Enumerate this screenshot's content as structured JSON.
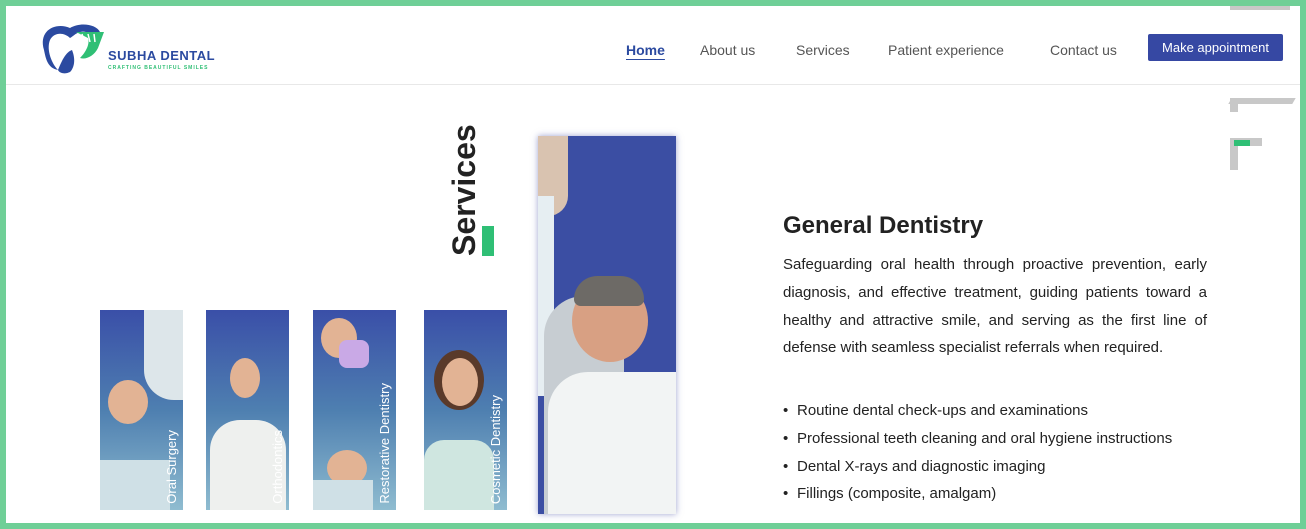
{
  "brand": {
    "name": "SUBHA DENTAL",
    "tagline": "CRAFTING BEAUTIFUL SMILES",
    "colors": {
      "primary": "#2b4aa0",
      "accent": "#2fbf75"
    }
  },
  "nav": {
    "items": [
      {
        "label": "Home",
        "active": true
      },
      {
        "label": "About us",
        "active": false
      },
      {
        "label": "Services",
        "active": false
      },
      {
        "label": "Patient experience",
        "active": false
      },
      {
        "label": "Contact us",
        "active": false
      }
    ],
    "cta": "Make appointment"
  },
  "services": {
    "title": "Services",
    "cards": [
      {
        "label": "Oral Surgery"
      },
      {
        "label": "Orthodontics"
      },
      {
        "label": "Restorative Dentistry"
      },
      {
        "label": "Cosmetic Dentistry"
      }
    ]
  },
  "content": {
    "title": "General Dentistry",
    "description": "Safeguarding oral health through proactive prevention, early diagnosis, and effective treatment, guiding patients toward a healthy and attractive smile, and serving as the first line of defense with seamless specialist referrals when required.",
    "bullets": [
      "Routine dental check-ups and examinations",
      "Professional teeth cleaning and oral hygiene instructions",
      "Dental X-rays and diagnostic imaging",
      "Fillings (composite, amalgam)"
    ]
  }
}
